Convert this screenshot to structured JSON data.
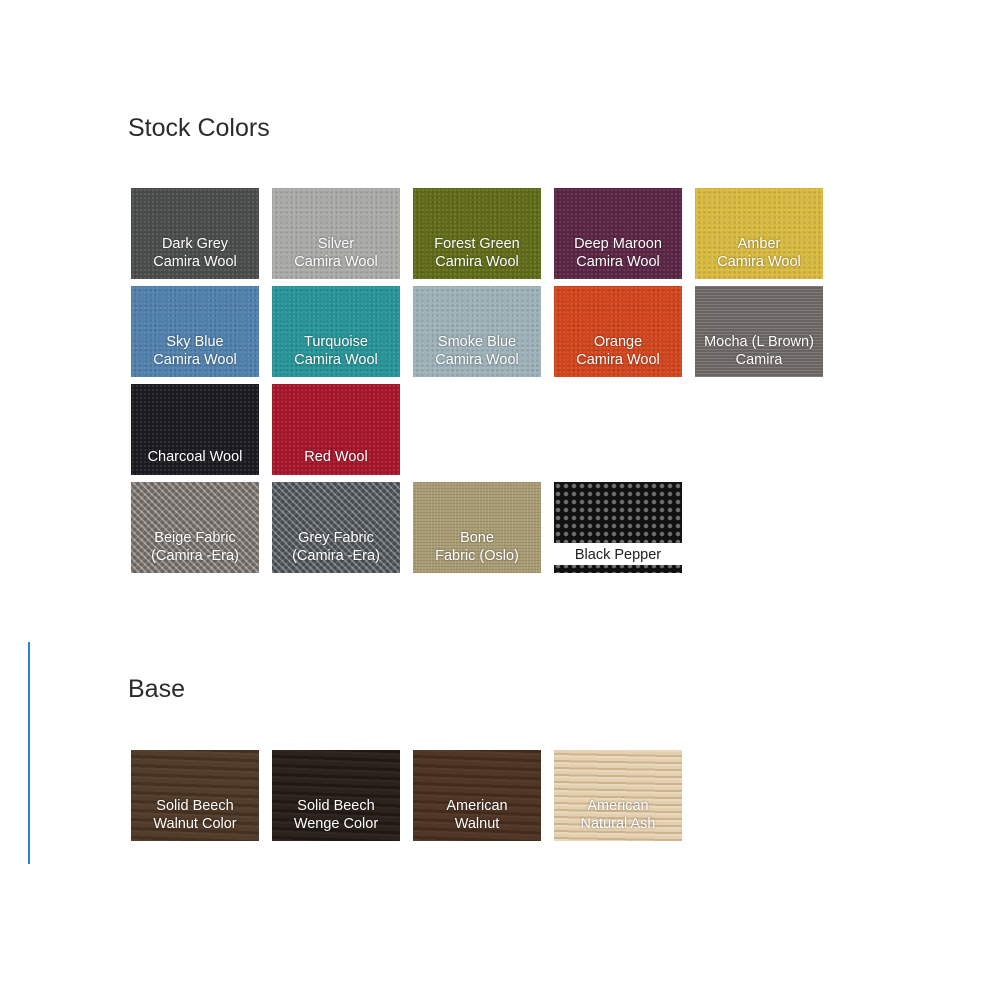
{
  "stock_title": "Stock Colors",
  "base_title": "Base",
  "stock": [
    {
      "label": "Dark Grey\nCamira Wool",
      "color": "#4a4c4c",
      "texture": "felt"
    },
    {
      "label": "Silver\nCamira Wool",
      "color": "#a9a9a7",
      "texture": "felt"
    },
    {
      "label": "Forest Green\nCamira Wool",
      "color": "#5f6b17",
      "texture": "felt"
    },
    {
      "label": "Deep Maroon\nCamira Wool",
      "color": "#5a2443",
      "texture": "felt"
    },
    {
      "label": "Amber\nCamira Wool",
      "color": "#d7b93f",
      "texture": "felt"
    },
    {
      "label": "Sky Blue\nCamira Wool",
      "color": "#4f80ac",
      "texture": "felt"
    },
    {
      "label": "Turquoise\nCamira Wool",
      "color": "#259497",
      "texture": "felt"
    },
    {
      "label": "Smoke Blue\nCamira Wool",
      "color": "#9db1b8",
      "texture": "felt"
    },
    {
      "label": "Orange\nCamira Wool",
      "color": "#d2441c",
      "texture": "felt"
    },
    {
      "label": "Mocha (L Brown)\nCamira",
      "color": "#756f6d",
      "texture": "stripe"
    },
    {
      "label": "Charcoal Wool",
      "color": "#1b1920",
      "texture": "felt"
    },
    {
      "label": "Red Wool",
      "color": "#a7152a",
      "texture": "felt"
    },
    null,
    null,
    null,
    {
      "label": "Beige Fabric\n(Camira -Era)",
      "color": "#8f8781",
      "texture": "herring"
    },
    {
      "label": "Grey Fabric\n(Camira -Era)",
      "color": "#5e646b",
      "texture": "herring"
    },
    {
      "label": "Bone\nFabric (Oslo)",
      "color": "#a99c74",
      "texture": "woven"
    },
    {
      "label": "Black Pepper",
      "color": "#161616",
      "texture": "mesh"
    }
  ],
  "base": [
    {
      "label": "Solid Beech\nWalnut Color",
      "color": "#4c3624",
      "texture": "wood"
    },
    {
      "label": "Solid Beech\nWenge Color",
      "color": "#241b15",
      "texture": "wood"
    },
    {
      "label": "American\nWalnut",
      "color": "#4a2f1f",
      "texture": "wood"
    },
    {
      "label": "American\nNatural Ash",
      "color": "#dcc49e",
      "texture": "ash"
    }
  ]
}
